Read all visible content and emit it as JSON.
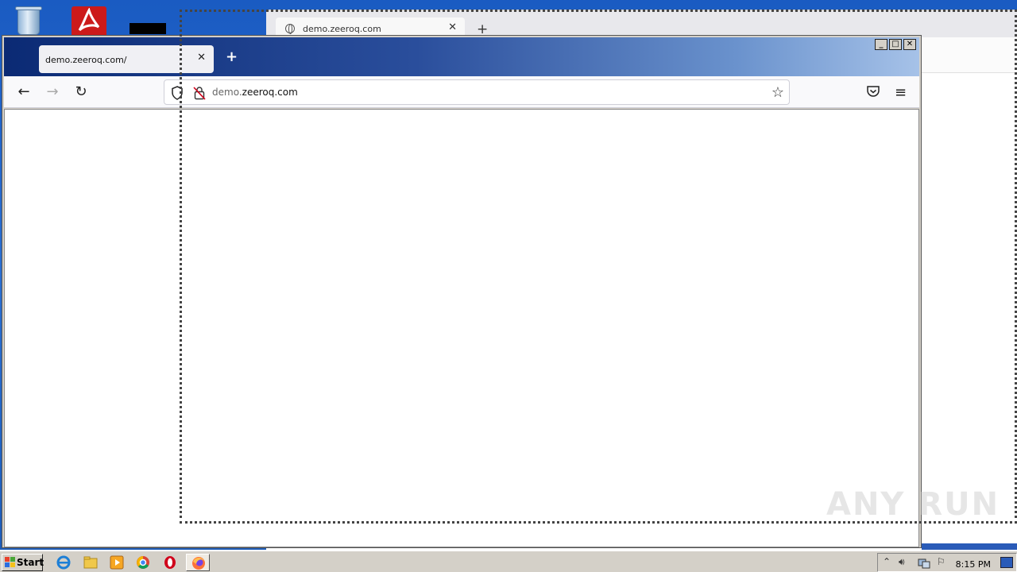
{
  "desktop": {
    "icons": [
      "recycle-bin-icon",
      "acrobat-reader-icon"
    ]
  },
  "background_window": {
    "tab_label": "demo.zeeroq.com",
    "close_glyph": "✕",
    "newtab_glyph": "+"
  },
  "browser": {
    "tab_label": "demo.zeeroq.com/",
    "tab_close_glyph": "✕",
    "newtab_glyph": "+",
    "window_buttons": {
      "minimize": "_",
      "maximize": "□",
      "close": "✕"
    },
    "nav": {
      "back": "←",
      "forward": "→",
      "reload": "↻"
    },
    "url_prefix": "demo.",
    "url_domain": "zeeroq.com",
    "bookmark_glyph": "☆",
    "menu_glyph": "≡"
  },
  "watermark": "ANY RUN",
  "taskbar": {
    "start_label": "Start",
    "clock": "8:15 PM",
    "tray_glyphs": {
      "expand": "⌃",
      "volume": "🔊︎",
      "flag": "⚐"
    }
  },
  "colors": {
    "desktop_blue": "#1a5bc2",
    "titlebar_dark": "#0b2a74",
    "titlebar_light": "#a6c2e8",
    "taskbar_grey": "#d4d0c8"
  }
}
